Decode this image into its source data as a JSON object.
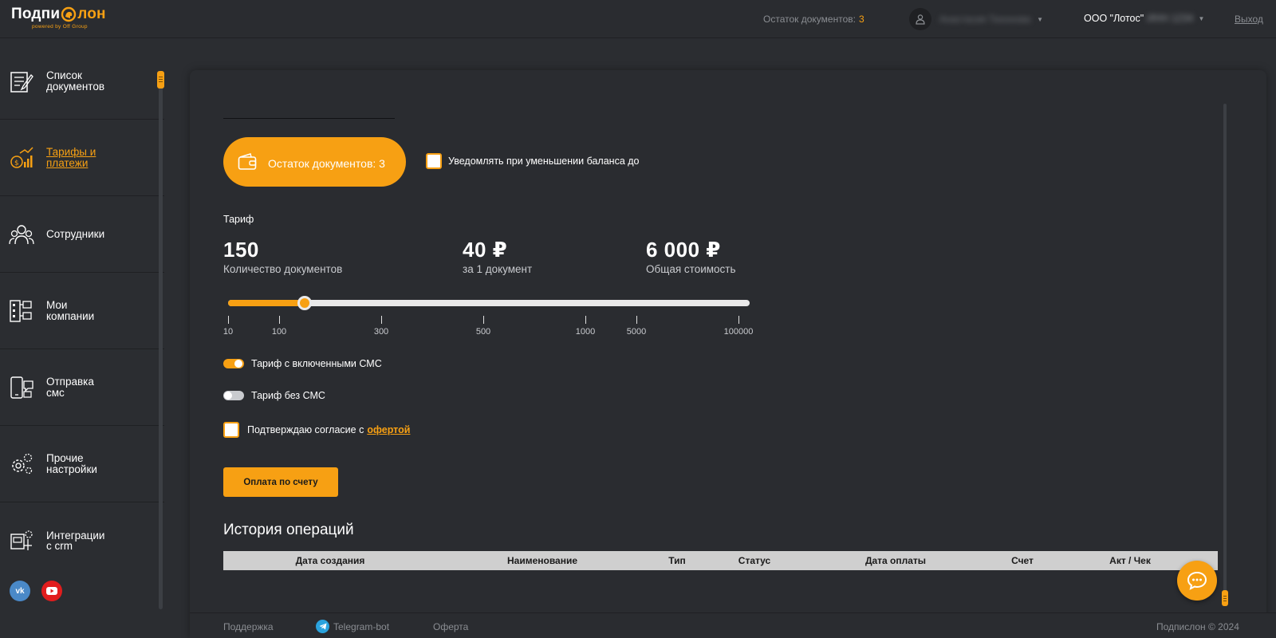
{
  "header": {
    "logo_part1": "Подпи",
    "logo_part2": "лон",
    "logo_sub": "powered by Off Group",
    "balance_label": "Остаток документов:",
    "balance_count": "3",
    "user_name": "Анастасия Тихонова",
    "company_name": "ООО \"Лотос\"",
    "company_extra": "ИНН 1234",
    "logout": "Выход"
  },
  "sidebar": {
    "items": [
      {
        "label": "Список\nдокументов",
        "icon": "document-list-icon"
      },
      {
        "label": "Тарифы и\nплатежи",
        "icon": "tariff-payment-icon",
        "active": true
      },
      {
        "label": "Сотрудники",
        "icon": "employees-icon"
      },
      {
        "label": "Мои\nкомпании",
        "icon": "companies-icon"
      },
      {
        "label": "Отправка\nсмс",
        "icon": "sms-send-icon"
      },
      {
        "label": "Прочие\nнастройки",
        "icon": "settings-icon"
      },
      {
        "label": "Интеграции\nс crm",
        "icon": "crm-integration-icon"
      }
    ],
    "social": {
      "vk": "vk",
      "youtube": "youtube"
    }
  },
  "balance": {
    "pill_text": "Остаток документов: 3",
    "notify_text": "Уведомлять при уменьшении баланса до"
  },
  "tariff": {
    "label": "Тариф",
    "documents_count": "150",
    "documents_label": "Количество документов",
    "price_per_doc": "40 ₽",
    "price_label": "за 1 документ",
    "total": "6 000 ₽",
    "total_label": "Общая стоимость",
    "slider_ticks": [
      "10",
      "100",
      "300",
      "500",
      "1000",
      "5000",
      "100000"
    ],
    "slider_value": "150"
  },
  "options": {
    "with_sms": "Тариф с включенными СМС",
    "with_sms_on": true,
    "without_sms": "Тариф без СМС",
    "without_sms_on": false,
    "agree_text": "Подтверждаю согласие с",
    "agree_link": "офертой",
    "pay_button": "Оплата по счету"
  },
  "history": {
    "title": "История операций",
    "columns": [
      "Дата создания",
      "Наименование",
      "Тип",
      "Статус",
      "Дата оплаты",
      "Счет",
      "Акт / Чек"
    ]
  },
  "footer": {
    "support": "Поддержка",
    "telegram": "Telegram-bot",
    "offer": "Оферта",
    "copyright": "Подпислон © 2024"
  },
  "colors": {
    "accent": "#f7a013",
    "background": "#2b2d31",
    "panel": "#2a2c30"
  }
}
